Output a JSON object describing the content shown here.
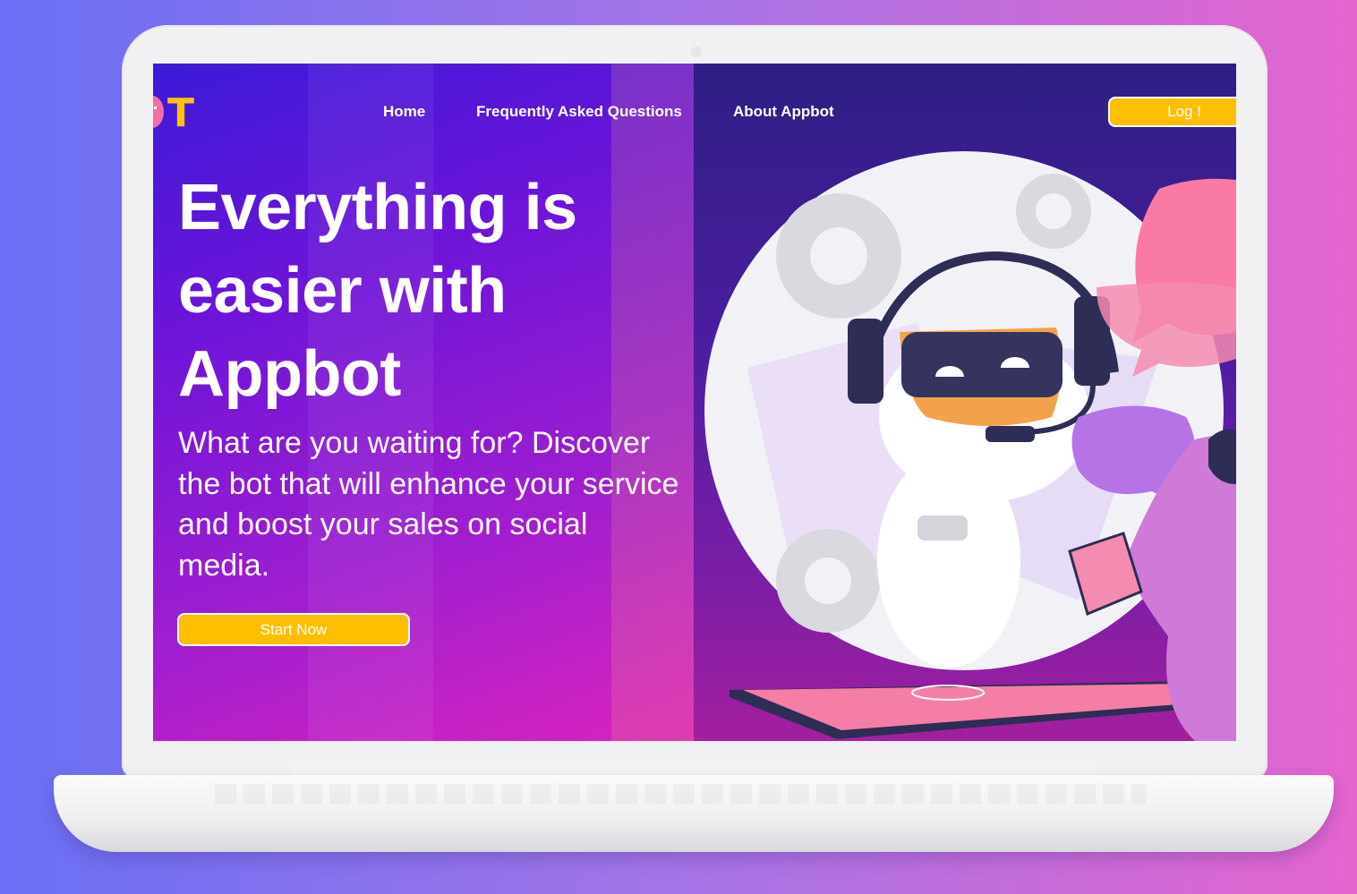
{
  "nav": {
    "items": [
      {
        "label": "Home"
      },
      {
        "label": "Frequently Asked Questions"
      },
      {
        "label": "About Appbot"
      }
    ],
    "login_label": "Log I"
  },
  "hero": {
    "title": "Everything is easier with Appbot",
    "subtitle": "What are you waiting for? Discover the bot that will enhance your service and boost your sales on social media.",
    "cta_label": "Start Now"
  },
  "logo": {
    "visible_letter": "T"
  },
  "colors": {
    "accent": "#ffbf00",
    "text": "#ffffff",
    "background_from": "#6a6ff5",
    "background_to": "#e565cf"
  }
}
